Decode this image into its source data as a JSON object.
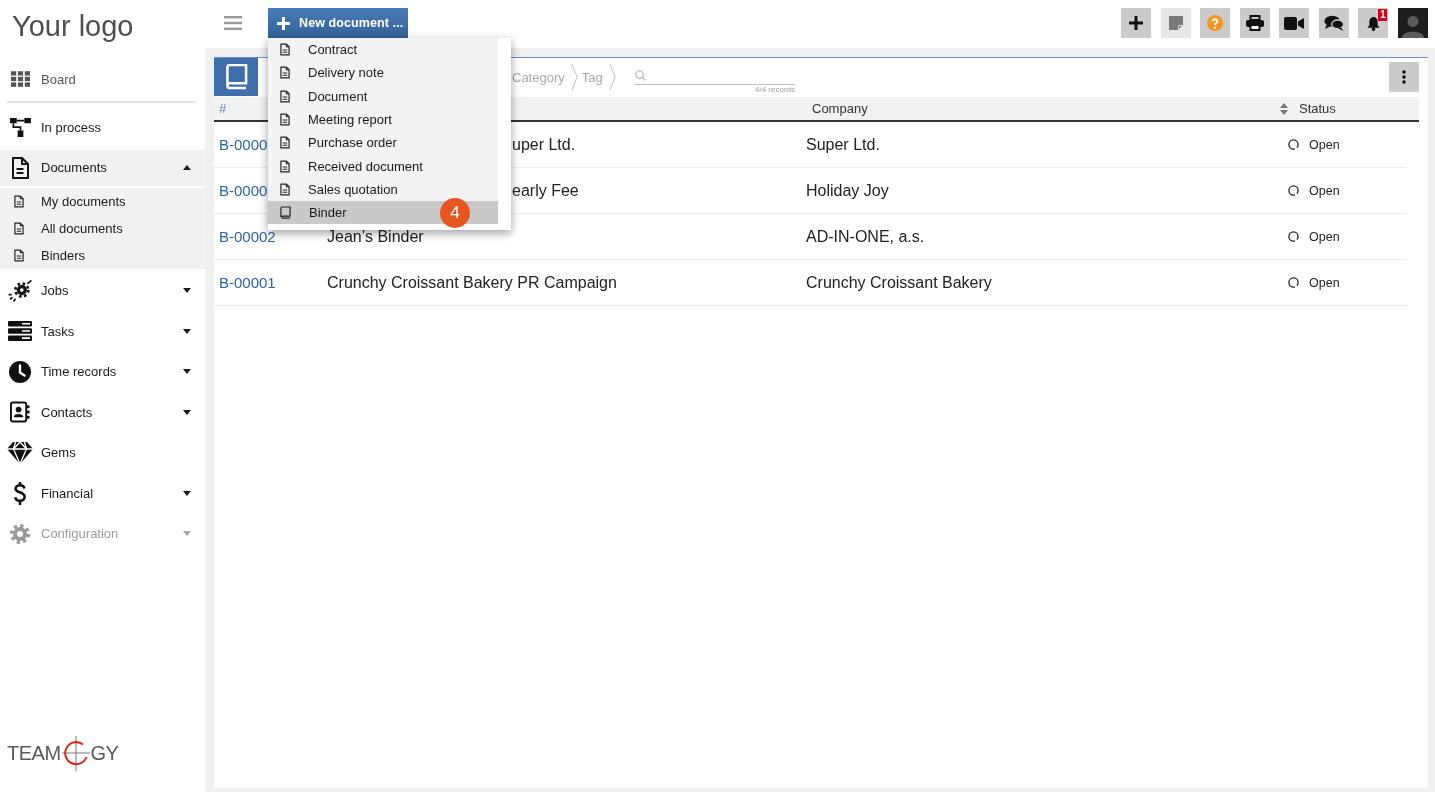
{
  "sidebar": {
    "logo": "Your logo",
    "board": {
      "label": "Board"
    },
    "items": [
      {
        "label": "In process",
        "disabled": false
      },
      {
        "label": "Documents",
        "disabled": false,
        "expanded": true,
        "children": [
          {
            "label": "My documents"
          },
          {
            "label": "All documents"
          },
          {
            "label": "Binders"
          }
        ]
      },
      {
        "label": "Jobs",
        "disabled": false,
        "expanded": false
      },
      {
        "label": "Tasks",
        "disabled": false,
        "expanded": false
      },
      {
        "label": "Time records",
        "disabled": false,
        "expanded": false
      },
      {
        "label": "Contacts",
        "disabled": false,
        "expanded": false
      },
      {
        "label": "Gems",
        "disabled": false
      },
      {
        "label": "Financial",
        "disabled": false,
        "expanded": false
      },
      {
        "label": "Configuration",
        "disabled": true,
        "expanded": false
      }
    ],
    "brand": {
      "before": "TEAM",
      "after": "GY"
    }
  },
  "topbar": {
    "new_document": {
      "label": "New document ...",
      "menu": [
        {
          "label": "Contract",
          "kind": "document",
          "selected": false
        },
        {
          "label": "Delivery note",
          "kind": "document",
          "selected": false
        },
        {
          "label": "Document",
          "kind": "document",
          "selected": false
        },
        {
          "label": "Meeting report",
          "kind": "document",
          "selected": false
        },
        {
          "label": "Purchase order",
          "kind": "document",
          "selected": false
        },
        {
          "label": "Received document",
          "kind": "document",
          "selected": false
        },
        {
          "label": "Sales quotation",
          "kind": "document",
          "selected": false
        },
        {
          "label": "Binder",
          "kind": "binder",
          "selected": true,
          "callout": "4"
        }
      ]
    },
    "actions": [
      {
        "kind": "add",
        "disabled": false
      },
      {
        "kind": "note",
        "disabled": true
      },
      {
        "kind": "help",
        "disabled": false
      },
      {
        "kind": "print",
        "disabled": false
      },
      {
        "kind": "video",
        "disabled": false
      },
      {
        "kind": "chat",
        "disabled": false
      },
      {
        "kind": "notifications",
        "disabled": false,
        "badge": "1"
      },
      {
        "kind": "avatar",
        "disabled": false
      }
    ]
  },
  "panel": {
    "breadcrumbs": [
      {
        "label": "Category"
      },
      {
        "label": "Tag"
      }
    ],
    "search": {
      "records": "4/4 records"
    },
    "table": {
      "columns": {
        "number": {
          "label": "#",
          "sortable": false
        },
        "company": {
          "label": "Company",
          "sortable": false
        },
        "status": {
          "label": "Status",
          "sortable": true
        }
      },
      "rows": [
        {
          "number": "B-0000",
          "name": "uper Ltd.",
          "company": "Super Ltd.",
          "status": "Open"
        },
        {
          "number": "B-0000",
          "name": "early Fee",
          "company": "Holiday Joy",
          "status": "Open"
        },
        {
          "number": "B-00002",
          "name": "Jean’s Binder",
          "company": "AD-IN-ONE, a.s.",
          "status": "Open"
        },
        {
          "number": "B-00001",
          "name": "Crunchy Croissant Bakery PR Campaign",
          "company": "Crunchy Croissant Bakery",
          "status": "Open"
        }
      ]
    }
  }
}
